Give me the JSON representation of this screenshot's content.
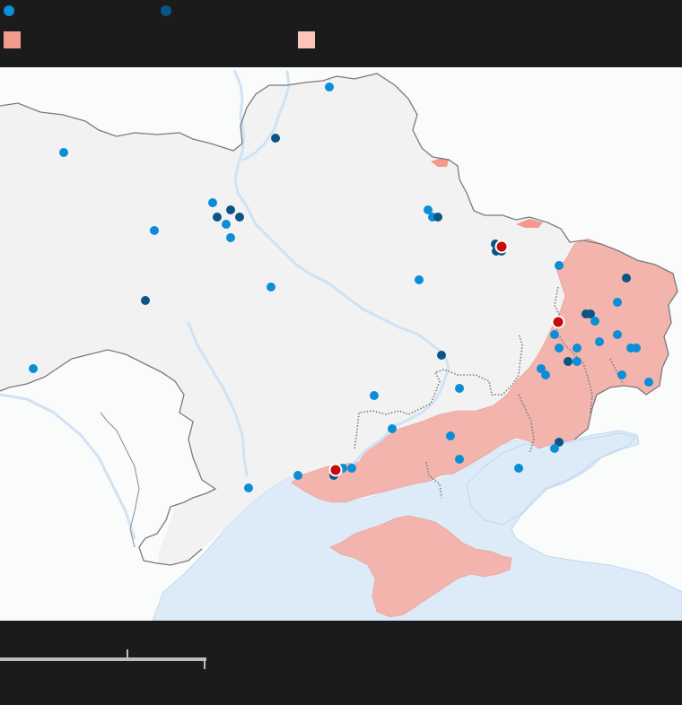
{
  "legend": {
    "items": [
      {
        "kind": "dot",
        "color": "#0a8fd6",
        "label": ""
      },
      {
        "kind": "dot",
        "color": "#0a5588",
        "label": ""
      },
      {
        "kind": "swatch",
        "color": "#f39a8e",
        "label": ""
      },
      {
        "kind": "swatch",
        "color": "#fbc3ba",
        "label": ""
      }
    ]
  },
  "map": {
    "colors": {
      "land_ukraine": "#f2f2f2",
      "land_neighbors": "#fafbfb",
      "border": "#7a7a7a",
      "occupied": "#f2b4ad",
      "occupied_strong": "#f39a8e",
      "water": "#ddeaf7",
      "river": "#cfe3f5",
      "dot_light": "#0a8fd6",
      "dot_dark": "#0a5588",
      "dot_red": "#c80a0a"
    },
    "icons": [
      "strike-dot-light-icon",
      "strike-dot-dark-icon",
      "strike-marker-red-icon"
    ]
  },
  "scale": {
    "label_left": "",
    "label_right": ""
  }
}
